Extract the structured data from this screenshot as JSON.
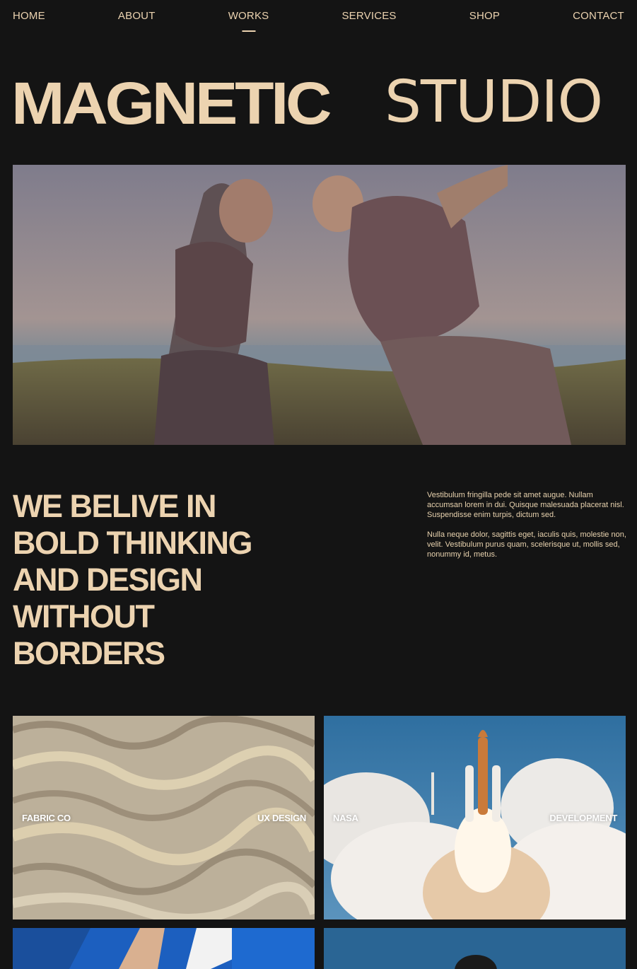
{
  "nav": {
    "items": [
      {
        "label": "HOME",
        "active": false
      },
      {
        "label": "ABOUT",
        "active": false
      },
      {
        "label": "WORKS",
        "active": true
      },
      {
        "label": "SERVICES",
        "active": false
      },
      {
        "label": "SHOP",
        "active": false
      },
      {
        "label": "CONTACT",
        "active": false
      }
    ]
  },
  "hero": {
    "title_bold": "MAGNETIC",
    "title_light": "STUDIO"
  },
  "intro": {
    "tagline_lines": [
      "WE BELIVE IN",
      "BOLD THINKING",
      "AND DESIGN",
      "WITHOUT",
      "BORDERS"
    ],
    "paragraphs": [
      "Vestibulum fringilla pede sit amet augue. Nullam accumsan lorem in dui. Quisque malesuada placerat nisl. Suspendisse enim turpis, dictum sed.",
      "Nulla neque dolor, sagittis eget, iaculis quis, molestie non, velit. Vestibulum purus quam, scelerisque ut, mollis sed, nonummy id, metus."
    ]
  },
  "works": [
    {
      "client": "FABRIC CO",
      "category": "UX DESIGN"
    },
    {
      "client": "NASA",
      "category": "DEVELOPMENT"
    }
  ],
  "colors": {
    "background": "#141414",
    "accent": "#ecd3b0",
    "card_label": "#ffffff"
  }
}
